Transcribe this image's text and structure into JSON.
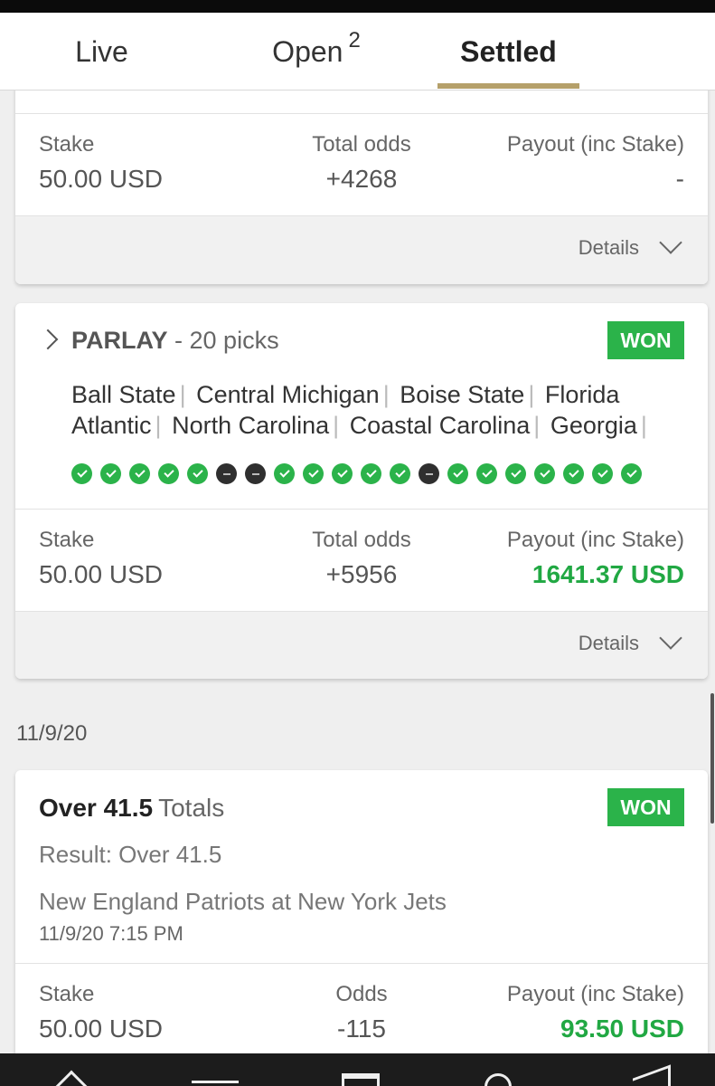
{
  "tabs": {
    "live": "Live",
    "open": "Open",
    "open_count": "2",
    "settled": "Settled"
  },
  "bet1": {
    "stake_label": "Stake",
    "stake": "50.00 USD",
    "odds_label": "Total odds",
    "odds": "+4268",
    "payout_label": "Payout (inc Stake)",
    "payout": "-",
    "details": "Details"
  },
  "bet2": {
    "type": "PARLAY",
    "picks": " - 20 picks",
    "status": "WON",
    "teams": [
      "Ball State",
      "Central Michigan",
      "Boise State",
      "Florida Atlantic",
      "North Carolina",
      "Coastal Carolina",
      "Georgia"
    ],
    "pick_results": [
      "won",
      "won",
      "won",
      "won",
      "won",
      "push",
      "push",
      "won",
      "won",
      "won",
      "won",
      "won",
      "push",
      "won",
      "won",
      "won",
      "won",
      "won",
      "won",
      "won"
    ],
    "stake_label": "Stake",
    "stake": "50.00 USD",
    "odds_label": "Total odds",
    "odds": "+5956",
    "payout_label": "Payout (inc Stake)",
    "payout": "1641.37 USD",
    "details": "Details"
  },
  "date_group": "11/9/20",
  "bet3": {
    "selection": "Over 41.5",
    "market": "Totals",
    "status": "WON",
    "result": "Result: Over 41.5",
    "event": "New England Patriots at New York Jets",
    "event_time": "11/9/20 7:15 PM",
    "stake_label": "Stake",
    "stake": "50.00 USD",
    "odds_label": "Odds",
    "odds": "-115",
    "payout_label": "Payout (inc Stake)",
    "payout": "93.50 USD"
  },
  "colors": {
    "won": "#2bb34a",
    "push": "#2f2f2f",
    "accent_underline": "#b5a06a"
  }
}
